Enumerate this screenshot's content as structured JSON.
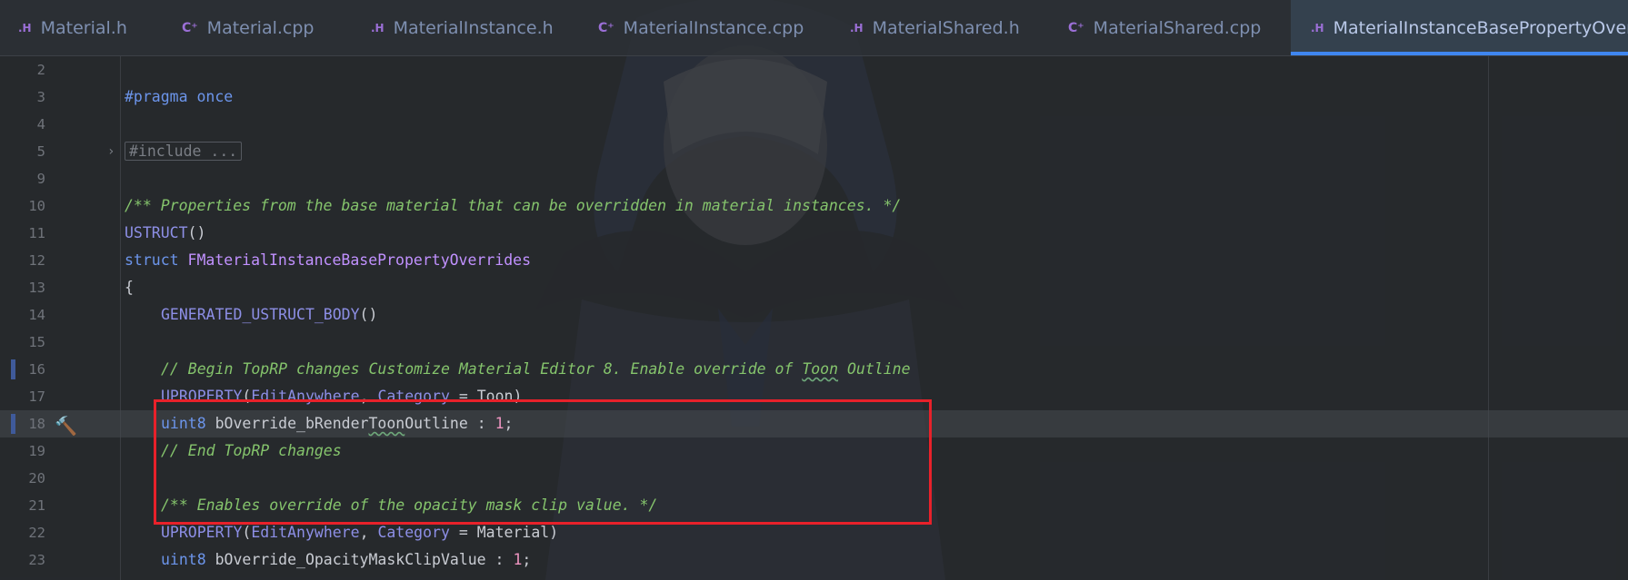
{
  "tabs": [
    {
      "type": ".H",
      "label": "Material.h"
    },
    {
      "type": "C⁺",
      "label": "Material.cpp"
    },
    {
      "type": ".H",
      "label": "MaterialInstance.h"
    },
    {
      "type": "C⁺",
      "label": "MaterialInstance.cpp"
    },
    {
      "type": ".H",
      "label": "MaterialShared.h"
    },
    {
      "type": "C⁺",
      "label": "MaterialShared.cpp"
    },
    {
      "type": ".H",
      "label": "MaterialInstanceBasePropertyOverrid"
    }
  ],
  "editor": {
    "line_numbers": [
      "2",
      "3",
      "4",
      "5",
      "9",
      "10",
      "11",
      "12",
      "13",
      "14",
      "15",
      "16",
      "17",
      "18",
      "19",
      "20",
      "21",
      "22",
      "23"
    ],
    "code": {
      "l3_a": "#pragma",
      "l3_b": " once",
      "l5": "#include ...",
      "l10": "/** Properties from the base material that can be overridden in material instances. */",
      "l11_a": "USTRUCT",
      "l11_b": "()",
      "l12_a": "struct",
      "l12_b": " FMaterialInstanceBasePropertyOverrides",
      "l13": "{",
      "l14_a": "GENERATED_USTRUCT_BODY",
      "l14_b": "()",
      "l16_a": "// Begin TopRP changes Customize Material Editor 8. Enable override of ",
      "l16_b": "Toon",
      "l16_c": " Outline",
      "l17_a": "UPROPERTY",
      "l17_b": "(",
      "l17_c": "EditAnywhere",
      "l17_d": ", ",
      "l17_e": "Category",
      "l17_f": " = Toon)",
      "l18_a": "uint8",
      "l18_b": " bOverride_bRender",
      "l18_c": "Toon",
      "l18_d": "Outline : ",
      "l18_e": "1",
      "l18_f": ";",
      "l19": "// End TopRP changes",
      "l21": "/** Enables override of the opacity mask clip value. */",
      "l22_a": "UPROPERTY",
      "l22_b": "(",
      "l22_c": "EditAnywhere",
      "l22_d": ", ",
      "l22_e": "Category",
      "l22_f": " = Material)",
      "l23_a": "uint8",
      "l23_b": " bOverride_OpacityMaskClipValue : ",
      "l23_c": "1",
      "l23_d": ";"
    }
  },
  "colors": {
    "accent": "#3f86f0",
    "highlight_box": "#e8212a"
  },
  "icons": {
    "gutter_hammer": "hammer-icon"
  }
}
